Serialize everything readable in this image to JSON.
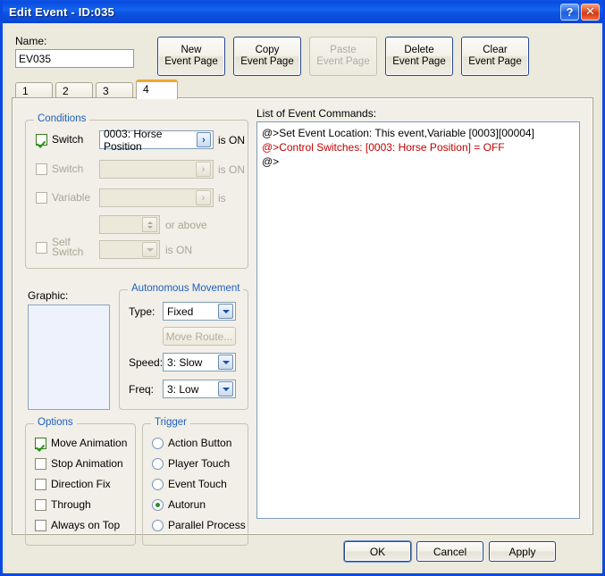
{
  "window": {
    "title": "Edit Event - ID:035",
    "help_button": "?",
    "close_button": "✕"
  },
  "header": {
    "name_label": "Name:",
    "name_value": "EV035",
    "name_placeholder": "",
    "buttons": [
      {
        "line1": "New",
        "line2": "Event Page",
        "enabled": true
      },
      {
        "line1": "Copy",
        "line2": "Event Page",
        "enabled": true
      },
      {
        "line1": "Paste",
        "line2": "Event Page",
        "enabled": false
      },
      {
        "line1": "Delete",
        "line2": "Event Page",
        "enabled": true
      },
      {
        "line1": "Clear",
        "line2": "Event Page",
        "enabled": true
      }
    ]
  },
  "tabs": {
    "items": [
      "1",
      "2",
      "3",
      "4"
    ],
    "active": "4"
  },
  "conditions": {
    "legend": "Conditions",
    "switch1": {
      "label": "Switch",
      "checked": true,
      "value": "0003: Horse Position",
      "suffix": "is ON",
      "button_glyph": "›"
    },
    "switch2": {
      "label": "Switch",
      "checked": false,
      "value": "",
      "suffix": "is ON",
      "button_glyph": "›"
    },
    "variable": {
      "label": "Variable",
      "checked": false,
      "value": "",
      "suffix": "is",
      "button_glyph": "›",
      "amount_value": "",
      "amount_suffix": "or above"
    },
    "self_switch": {
      "label_line1": "Self",
      "label_line2": "Switch",
      "checked": false,
      "value": "",
      "suffix": "is ON"
    }
  },
  "graphic": {
    "label": "Graphic:"
  },
  "autonomous_movement": {
    "legend": "Autonomous Movement",
    "type_label": "Type:",
    "type_value": "Fixed",
    "move_route_label": "Move Route...",
    "move_route_enabled": false,
    "speed_label": "Speed:",
    "speed_value": "3: Slow",
    "freq_label": "Freq:",
    "freq_value": "3: Low"
  },
  "options": {
    "legend": "Options",
    "items": [
      {
        "label": "Move Animation",
        "checked": true
      },
      {
        "label": "Stop Animation",
        "checked": false
      },
      {
        "label": "Direction Fix",
        "checked": false
      },
      {
        "label": "Through",
        "checked": false
      },
      {
        "label": "Always on Top",
        "checked": false
      }
    ]
  },
  "trigger": {
    "legend": "Trigger",
    "items": [
      {
        "label": "Action Button",
        "selected": false
      },
      {
        "label": "Player Touch",
        "selected": false
      },
      {
        "label": "Event Touch",
        "selected": false
      },
      {
        "label": "Autorun",
        "selected": true
      },
      {
        "label": "Parallel Process",
        "selected": false
      }
    ]
  },
  "commands": {
    "label": "List of Event Commands:",
    "lines": [
      {
        "text": "@>Set Event Location: This event,Variable [0003][00004]",
        "color": "black"
      },
      {
        "text": "@>Control Switches: [0003: Horse Position] = OFF",
        "color": "red"
      },
      {
        "text": "@>",
        "color": "black"
      }
    ]
  },
  "footer": {
    "ok": "OK",
    "cancel": "Cancel",
    "apply": "Apply"
  },
  "colors": {
    "titlebar": "#0a4ae0",
    "group_legend": "#1f5fbf",
    "command_red": "#c00000",
    "active_tab_accent": "#f0a830",
    "face": "#ece9dd"
  }
}
